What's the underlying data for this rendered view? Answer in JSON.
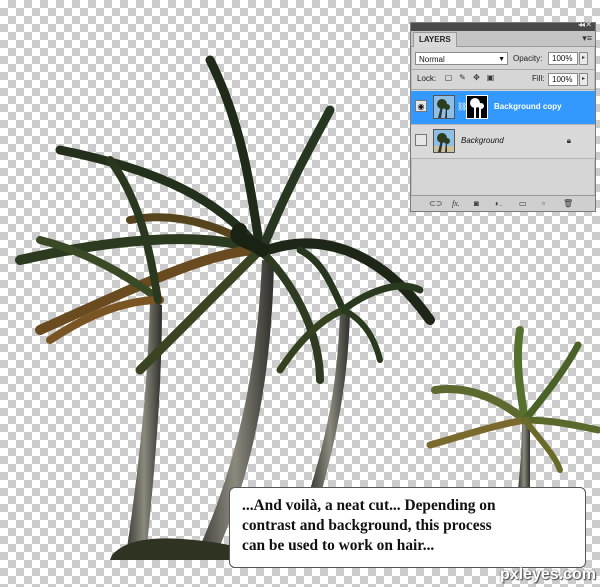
{
  "layers_panel": {
    "tab_label": "LAYERS",
    "blend_mode": "Normal",
    "opacity_label": "Opacity:",
    "opacity_value": "100%",
    "lock_label": "Lock:",
    "fill_label": "Fill:",
    "fill_value": "100%",
    "layers": [
      {
        "name": "Background copy",
        "selected": true,
        "visible": true,
        "has_mask": true
      },
      {
        "name": "Background",
        "selected": false,
        "visible": false,
        "locked": true
      }
    ]
  },
  "caption": {
    "lines": [
      "...And voilà, a neat cut... Depending on",
      "contrast and background, this process",
      "can be used to work on hair..."
    ]
  },
  "watermark": "pxleyes.com",
  "colors": {
    "selection": "#3399ff",
    "panel_bg": "#d6d6d6",
    "checker": "#cccccc"
  }
}
